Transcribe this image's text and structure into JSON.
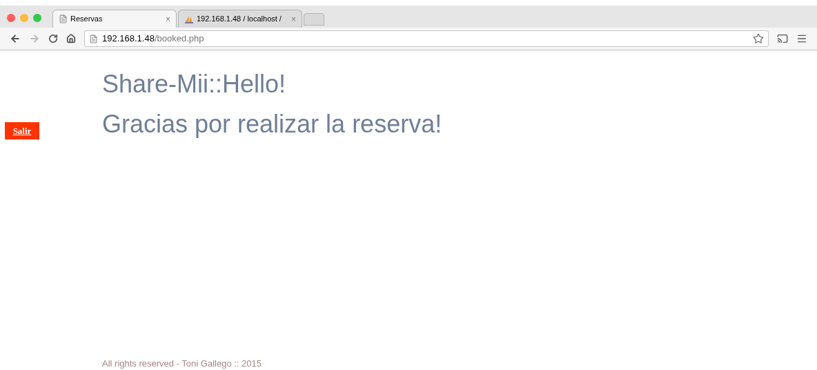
{
  "browser": {
    "tabs": [
      {
        "title": "Reservas",
        "close": "×",
        "selected": true
      },
      {
        "title": "192.168.1.48 / localhost /",
        "close": "×",
        "selected": false
      }
    ],
    "address": {
      "host": "192.168.1.48",
      "path": "/booked.php"
    }
  },
  "page": {
    "logout": "Salir",
    "headings": [
      "Share-Mii::Hello!",
      "Gracias por realizar la reserva!"
    ],
    "footer": "All rights reserved - Toni Gallego :: 2015"
  }
}
